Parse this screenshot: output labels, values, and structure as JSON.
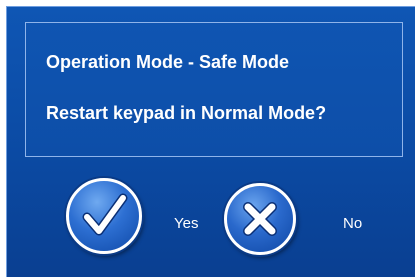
{
  "dialog": {
    "line1": "Operation Mode - Safe Mode",
    "line2": "Restart keypad in Normal Mode?"
  },
  "buttons": {
    "yes_label": "Yes",
    "no_label": "No"
  },
  "icons": {
    "yes": "checkmark-icon",
    "no": "close-icon"
  },
  "colors": {
    "background": "#0b4aa3",
    "text": "#ffffff",
    "panel_border": "#8fb4ea"
  }
}
